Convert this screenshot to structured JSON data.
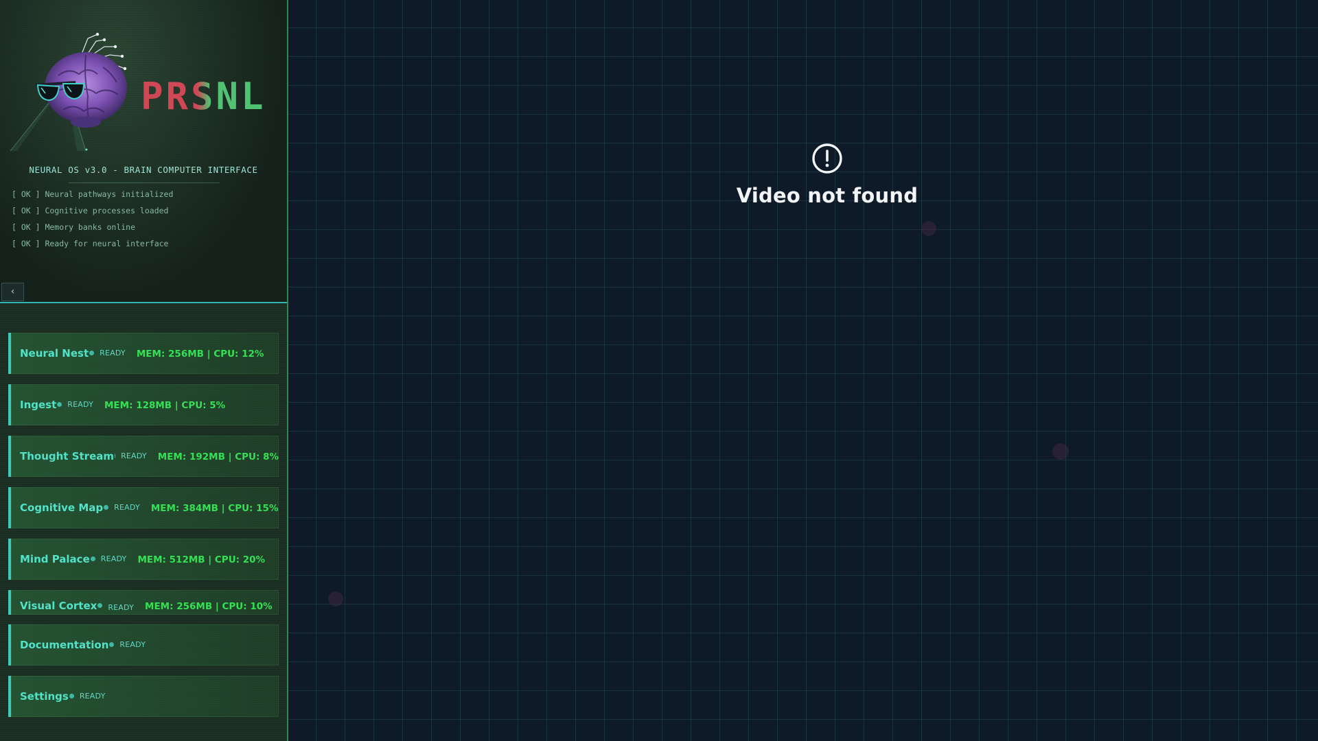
{
  "sidebar": {
    "brand": "PRSNL",
    "os_title": "NEURAL OS v3.0 - BRAIN COMPUTER INTERFACE",
    "boot_log": [
      "[ OK ] Neural pathways initialized",
      "[ OK ] Cognitive processes loaded",
      "[ OK ] Memory banks online",
      "[ OK ] Ready for neural interface"
    ],
    "collapse_label": "‹",
    "nav_items": [
      {
        "name": "Neural Nest",
        "status": "READY",
        "metrics": "MEM: 256MB | CPU: 12%"
      },
      {
        "name": "Ingest",
        "status": "READY",
        "metrics": "MEM: 128MB | CPU: 5%"
      },
      {
        "name": "Thought Stream",
        "status": "READY",
        "metrics": "MEM: 192MB | CPU: 8%"
      },
      {
        "name": "Cognitive Map",
        "status": "READY",
        "metrics": "MEM: 384MB | CPU: 15%"
      },
      {
        "name": "Mind Palace",
        "status": "READY",
        "metrics": "MEM: 512MB | CPU: 20%"
      },
      {
        "name": "Visual Cortex",
        "status": "READY",
        "metrics": "MEM: 256MB | CPU: 10%"
      },
      {
        "name": "Documentation",
        "status": "READY",
        "metrics": ""
      },
      {
        "name": "Settings",
        "status": "READY",
        "metrics": ""
      }
    ]
  },
  "main": {
    "video_error": "Video not found",
    "icon": "alert-circle-icon"
  },
  "colors": {
    "accent": "#3fc9b8",
    "metrics": "#35e055",
    "background": "#0e1a28"
  }
}
